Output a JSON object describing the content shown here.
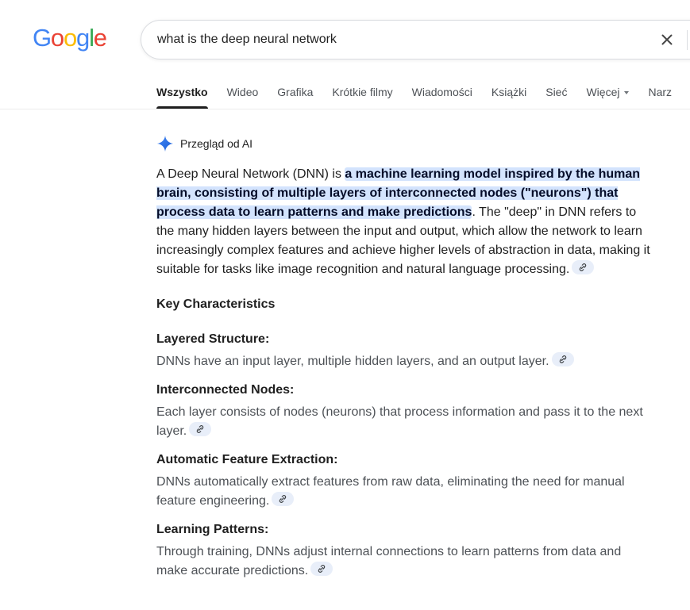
{
  "logo": {
    "letters": [
      "G",
      "o",
      "o",
      "g",
      "l",
      "e"
    ]
  },
  "search": {
    "query": "what is the deep neural network",
    "clear_icon": "close-icon"
  },
  "tabs": [
    {
      "label": "Wszystko",
      "active": true
    },
    {
      "label": "Wideo"
    },
    {
      "label": "Grafika"
    },
    {
      "label": "Krótkie filmy"
    },
    {
      "label": "Wiadomości"
    },
    {
      "label": "Książki"
    },
    {
      "label": "Sieć"
    },
    {
      "label": "Więcej",
      "dropdown": true
    },
    {
      "label": "Narz"
    }
  ],
  "ai_overview": {
    "title": "Przegląd od AI",
    "icon": "sparkle-icon",
    "intro_before": "A Deep Neural Network (DNN) is ",
    "intro_highlight": "a machine learning model inspired by the human brain, consisting of multiple layers of interconnected nodes (\"neurons\") that process data to learn patterns and make predictions",
    "intro_after": ". The \"deep\" in DNN refers to the many hidden layers between the input and output, which allow the network to learn increasingly complex features and achieve higher levels of abstraction in data, making it suitable for tasks like image recognition and natural language processing.",
    "section_title": "Key Characteristics",
    "items": [
      {
        "heading": "Layered Structure:",
        "description": "DNNs have an input layer, multiple hidden layers, and an output layer."
      },
      {
        "heading": "Interconnected Nodes:",
        "description": "Each layer consists of nodes (neurons) that process information and pass it to the next layer."
      },
      {
        "heading": "Automatic Feature Extraction:",
        "description": "DNNs automatically extract features from raw data, eliminating the need for manual feature engineering."
      },
      {
        "heading": "Learning Patterns:",
        "description": "Through training, DNNs adjust internal connections to learn patterns from data and make accurate predictions."
      }
    ]
  },
  "colors": {
    "highlight": "#d3e3fd",
    "citation_chip": "#e8eef9",
    "text_secondary": "#4d5156",
    "google_blue": "#4285f4",
    "google_red": "#ea4335",
    "google_yellow": "#fbbc05",
    "google_green": "#34a853"
  }
}
